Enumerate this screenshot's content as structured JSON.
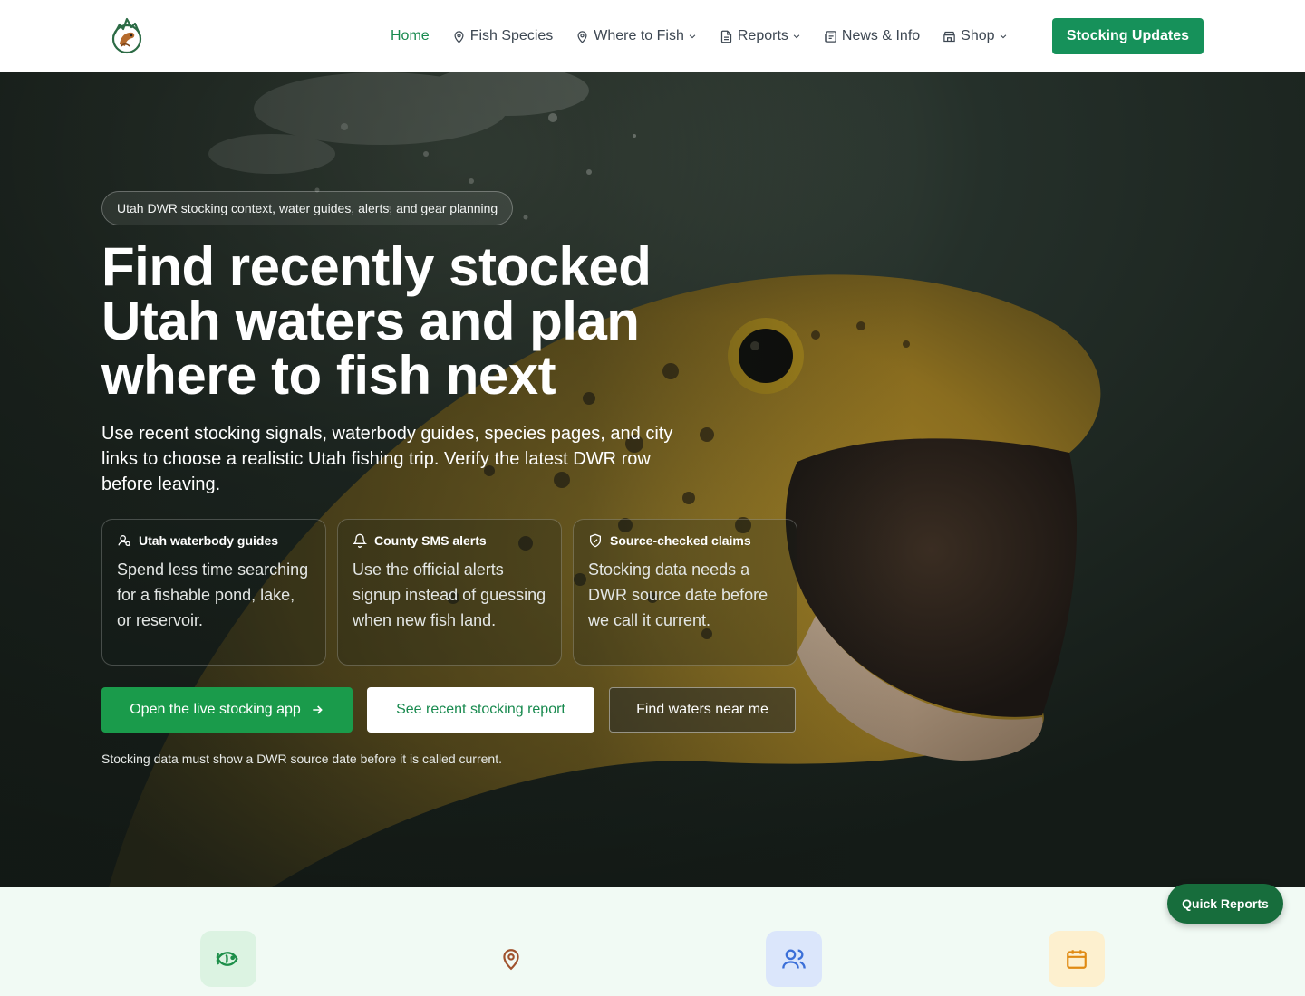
{
  "nav": {
    "items": [
      {
        "label": "Home",
        "icon": "",
        "dropdown": false
      },
      {
        "label": "Fish Species",
        "icon": "map-pin-icon",
        "dropdown": false
      },
      {
        "label": "Where to Fish",
        "icon": "map-pin-icon",
        "dropdown": true
      },
      {
        "label": "Reports",
        "icon": "document-icon",
        "dropdown": true
      },
      {
        "label": "News & Info",
        "icon": "newspaper-icon",
        "dropdown": false
      },
      {
        "label": "Shop",
        "icon": "store-icon",
        "dropdown": true
      }
    ],
    "cta_label": "Stocking Updates"
  },
  "hero": {
    "eyebrow": "Utah DWR stocking context, water guides, alerts, and gear planning",
    "title": "Find recently stocked Utah waters and plan where to fish next",
    "subtitle": "Use recent stocking signals, waterbody guides, species pages, and city links to choose a realistic Utah fishing trip. Verify the latest DWR row before leaving.",
    "cards": [
      {
        "icon": "user-search-icon",
        "title": "Utah waterbody guides",
        "body": "Spend less time searching for a fishable pond, lake, or reservoir."
      },
      {
        "icon": "bell-icon",
        "title": "County SMS alerts",
        "body": "Use the official alerts signup instead of guessing when new fish land."
      },
      {
        "icon": "shield-check-icon",
        "title": "Source-checked claims",
        "body": "Stocking data needs a DWR source date before we call it current."
      }
    ],
    "buttons": {
      "primary": "Open the live stocking app",
      "secondary": "See recent stocking report",
      "tertiary": "Find waters near me"
    },
    "note": "Stocking data must show a DWR source date before it is called current."
  },
  "features": {
    "icons": [
      "fish-icon",
      "map-pin-icon",
      "users-icon",
      "calendar-icon"
    ]
  },
  "quick_reports": "Quick Reports",
  "colors": {
    "brand_green": "#16915a",
    "primary_button": "#1a9b4b",
    "nav_active": "#198a4f",
    "quick_reports_bg": "#176d3c",
    "features_bg": "#f1faf4"
  }
}
